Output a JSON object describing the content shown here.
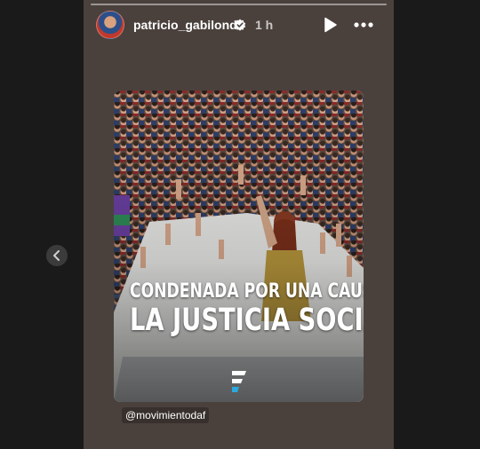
{
  "story": {
    "username": "patricio_gabilondo",
    "time": "1 h",
    "icons": {
      "verified": "verified-badge-icon",
      "play": "play-icon",
      "more": "more-options-icon",
      "prev": "chevron-left-icon"
    }
  },
  "post": {
    "headline_line1": "CONDENADA POR UNA CAUSA:",
    "headline_line2": "LA JUSTICIA SOCIAL",
    "logo_icon": "movimiento-logo-icon",
    "mention": "@movimientodaf"
  },
  "colors": {
    "story_background": "#4a413d",
    "page_background": "#1a1a1a",
    "dress": "#b8973c"
  }
}
